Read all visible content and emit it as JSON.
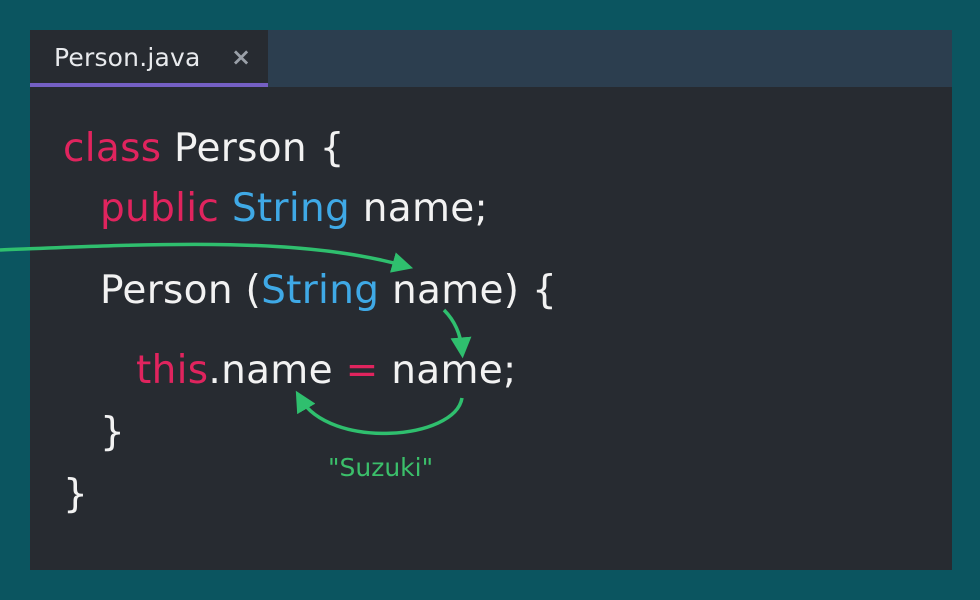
{
  "tab": {
    "label": "Person.java",
    "close": "×"
  },
  "code": {
    "line1": {
      "kw": "class",
      "rest": " Person {"
    },
    "line2": {
      "kw": "public",
      "type": "String",
      "rest": " name;"
    },
    "line3": {
      "pre": "Person (",
      "type": "String",
      "rest": " name) {"
    },
    "line4": {
      "kw": "this",
      "mid": ".name ",
      "op": "=",
      "rest": " name;"
    },
    "line5": {
      "text": "}"
    },
    "line6": {
      "text": "}"
    }
  },
  "annotation": {
    "value": "\"Suzuki\""
  },
  "colors": {
    "keyword": "#e0245e",
    "type": "#3fa9e6",
    "arrow": "#2fbf6e",
    "background": "#0b5560",
    "editor": "#272b31",
    "tab_accent": "#7560c4"
  }
}
